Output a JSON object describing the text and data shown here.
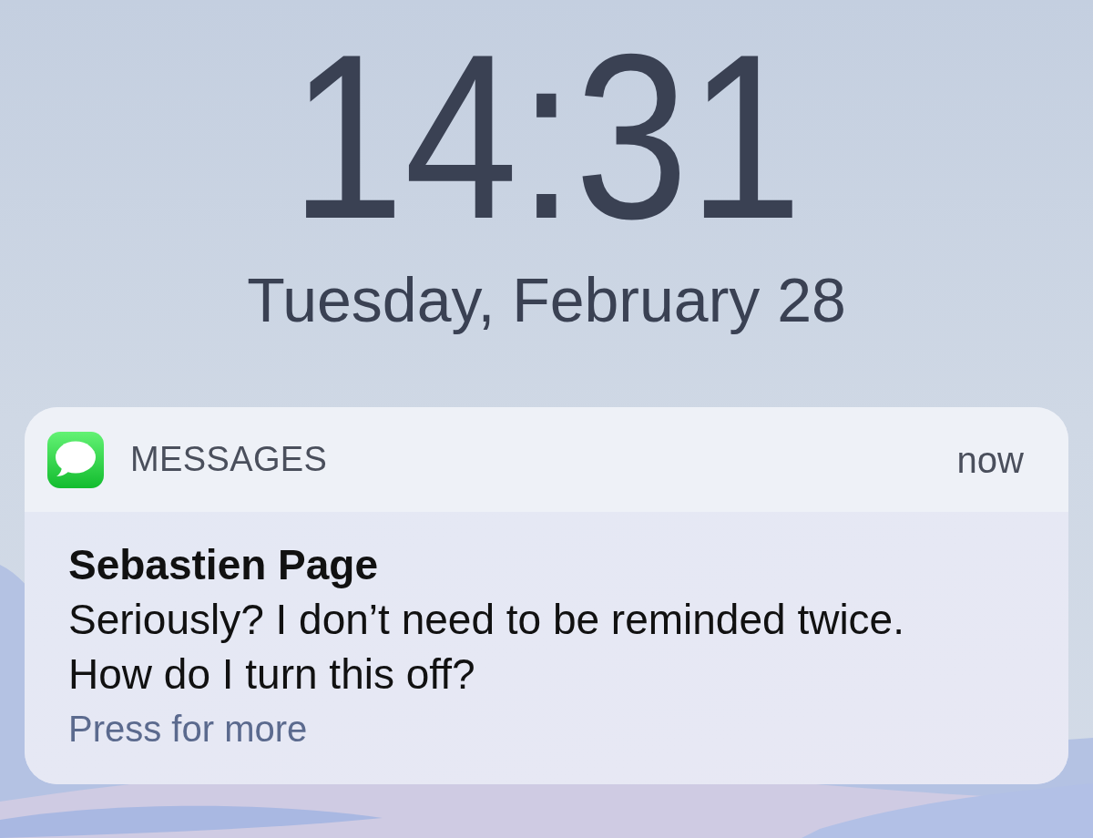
{
  "clock": {
    "time": "14:31",
    "date": "Tuesday, February 28"
  },
  "notification": {
    "app": "MESSAGES",
    "time": "now",
    "sender": "Sebastien Page",
    "message": "Seriously? I don’t need to be reminded twice. How do I turn this off?",
    "hint": "Press for more"
  }
}
